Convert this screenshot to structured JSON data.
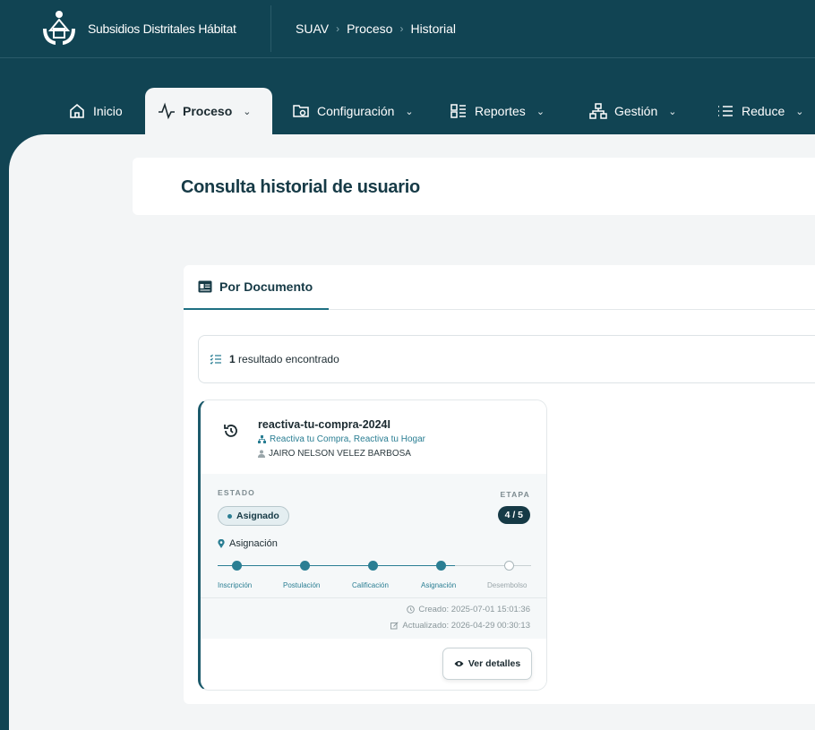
{
  "header": {
    "app_title": "Subsidios Distritales Hábitat",
    "breadcrumb": [
      "SUAV",
      "Proceso",
      "Historial"
    ]
  },
  "nav": [
    {
      "label": "Inicio",
      "icon": "home-icon",
      "active": false,
      "dropdown": false
    },
    {
      "label": "Proceso",
      "icon": "activity-icon",
      "active": true,
      "dropdown": true
    },
    {
      "label": "Configuración",
      "icon": "folder-settings-icon",
      "active": false,
      "dropdown": true
    },
    {
      "label": "Reportes",
      "icon": "report-list-icon",
      "active": false,
      "dropdown": true
    },
    {
      "label": "Gestión",
      "icon": "hierarchy-icon",
      "active": false,
      "dropdown": true
    },
    {
      "label": "Reduce",
      "icon": "list-icon",
      "active": false,
      "dropdown": true
    }
  ],
  "page_title": "Consulta historial de usuario",
  "tabs": [
    {
      "label": "Por Documento",
      "icon": "id-card-icon",
      "active": true
    }
  ],
  "results": {
    "count": "1",
    "text": "resultado encontrado"
  },
  "card": {
    "title": "reactiva-tu-compra-2024I",
    "program": "Reactiva tu Compra, Reactiva tu Hogar",
    "user": "JAIRO NELSON VELEZ BARBOSA",
    "estado_label": "ESTADO",
    "etapa_label": "ETAPA",
    "estado": "Asignado",
    "etapa": "4 / 5",
    "fase": "Asignación",
    "steps": [
      {
        "label": "Inscripción",
        "done": true
      },
      {
        "label": "Postulación",
        "done": true
      },
      {
        "label": "Calificación",
        "done": true
      },
      {
        "label": "Asignación",
        "done": true
      },
      {
        "label": "Desembolso",
        "done": false
      }
    ],
    "creado": "Creado: 2025-07-01 15:01:36",
    "actualizado": "Actualizado: 2026-04-29 00:30:13",
    "button": "Ver detalles"
  },
  "colors": {
    "primary": "#114453",
    "accent": "#2a7e93",
    "background": "#f3f5f6"
  }
}
